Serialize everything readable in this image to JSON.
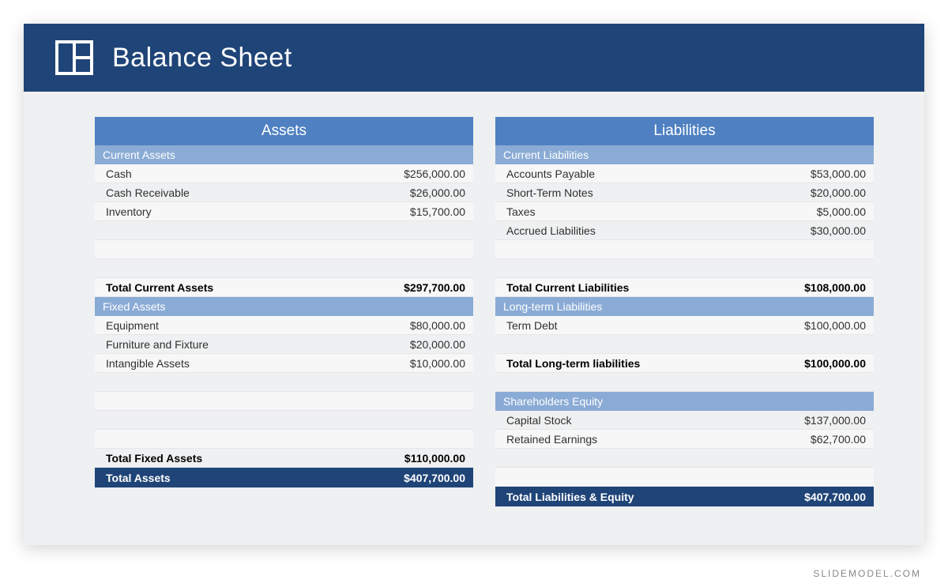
{
  "title": "Balance Sheet",
  "watermark": "SLIDEMODEL.COM",
  "colors": {
    "header": "#1f4477",
    "colHeader": "#4f80c1",
    "subHeader": "#8aabd5"
  },
  "assets": {
    "header": "Assets",
    "currentHeader": "Current Assets",
    "currentItems": [
      {
        "label": "Cash",
        "value": "$256,000.00"
      },
      {
        "label": "Cash Receivable",
        "value": "$26,000.00"
      },
      {
        "label": "Inventory",
        "value": "$15,700.00"
      }
    ],
    "totalCurrent": {
      "label": "Total Current Assets",
      "value": "$297,700.00"
    },
    "fixedHeader": "Fixed Assets",
    "fixedItems": [
      {
        "label": "Equipment",
        "value": "$80,000.00"
      },
      {
        "label": "Furniture and Fixture",
        "value": "$20,000.00"
      },
      {
        "label": "Intangible Assets",
        "value": "$10,000.00"
      }
    ],
    "totalFixed": {
      "label": "Total Fixed Assets",
      "value": "$110,000.00"
    },
    "grand": {
      "label": "Total Assets",
      "value": "$407,700.00"
    }
  },
  "liabilities": {
    "header": "Liabilities",
    "currentHeader": "Current Liabilities",
    "currentItems": [
      {
        "label": "Accounts Payable",
        "value": "$53,000.00"
      },
      {
        "label": "Short-Term Notes",
        "value": "$20,000.00"
      },
      {
        "label": "Taxes",
        "value": "$5,000.00"
      },
      {
        "label": "Accrued Liabilities",
        "value": "$30,000.00"
      }
    ],
    "totalCurrent": {
      "label": "Total Current Liabilities",
      "value": "$108,000.00"
    },
    "longHeader": "Long-term Liabilities",
    "longItems": [
      {
        "label": "Term Debt",
        "value": "$100,000.00"
      }
    ],
    "totalLong": {
      "label": "Total Long-term liabilities",
      "value": "$100,000.00"
    },
    "equityHeader": "Shareholders Equity",
    "equityItems": [
      {
        "label": "Capital Stock",
        "value": "$137,000.00"
      },
      {
        "label": "Retained Earnings",
        "value": "$62,700.00"
      }
    ],
    "grand": {
      "label": "Total Liabilities & Equity",
      "value": "$407,700.00"
    }
  }
}
